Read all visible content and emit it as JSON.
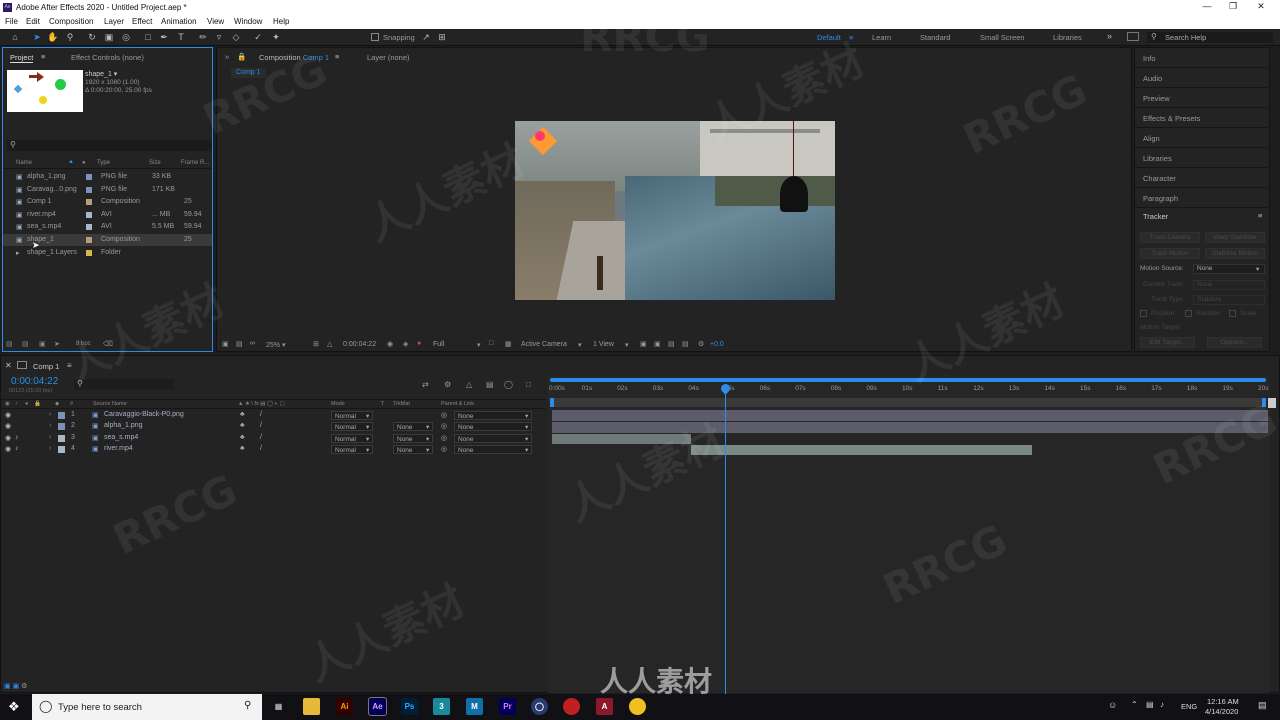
{
  "window": {
    "title": "Adobe After Effects 2020 - Untitled Project.aep *",
    "app_icon": "Ae"
  },
  "menu": [
    "File",
    "Edit",
    "Composition",
    "Layer",
    "Effect",
    "Animation",
    "View",
    "Window",
    "Help"
  ],
  "toolbar": {
    "snapping_label": "Snapping",
    "workspaces": [
      "Default",
      "Learn",
      "Standard",
      "Small Screen",
      "Libraries"
    ],
    "active_workspace": "Default",
    "search_placeholder": "Search Help"
  },
  "project_panel": {
    "tab_project": "Project",
    "tab_effect_controls": "Effect Controls (none)",
    "selected_name": "shape_1 ▾",
    "selected_res": "1920 x 1080 (1.00)",
    "selected_dur": "Δ 0:00:20:00, 25.00 fps",
    "columns": [
      "Name",
      "Type",
      "Size",
      "Frame R..."
    ],
    "items": [
      {
        "name": "alpha_1.png",
        "type": "PNG file",
        "size": "33 KB",
        "fps": "",
        "color": "#7a93b8"
      },
      {
        "name": "Caravag...0.png",
        "type": "PNG file",
        "size": "171 KB",
        "fps": "",
        "color": "#7a93b8"
      },
      {
        "name": "Comp 1",
        "type": "Composition",
        "size": "",
        "fps": "25",
        "color": "#b8a07a"
      },
      {
        "name": "river.mp4",
        "type": "AVI",
        "size": "... MB",
        "fps": "59.94",
        "color": "#a4b8c8"
      },
      {
        "name": "sea_s.mp4",
        "type": "AVI",
        "size": "5.5 MB",
        "fps": "59.94",
        "color": "#a4b8c8"
      },
      {
        "name": "shape_1",
        "type": "Composition",
        "size": "",
        "fps": "25",
        "color": "#b8a07a"
      },
      {
        "name": "shape_1 Layers",
        "type": "Folder",
        "size": "",
        "fps": "",
        "color": "#d8b84a"
      }
    ],
    "bpc": "8 bpc"
  },
  "comp_panel": {
    "tab_label": "Composition",
    "tab_comp": "Comp 1",
    "layer_tab": "Layer (none)",
    "breadcrumb": "Comp 1",
    "zoom": "25%",
    "timecode": "0:00:04:22",
    "resolution": "Full",
    "camera": "Active Camera",
    "views": "1 View",
    "exposure": "+0.0"
  },
  "right_panel": {
    "items": [
      "Info",
      "Audio",
      "Preview",
      "Effects & Presets",
      "Align",
      "Libraries",
      "Character",
      "Paragraph"
    ],
    "tracker_title": "Tracker",
    "buttons": [
      "Track Camera",
      "Warp Stabilizer",
      "Track Motion",
      "Stabilize Motion"
    ],
    "motion_source_label": "Motion Source:",
    "motion_source_value": "None",
    "current_track_label": "Current Track:",
    "current_track_value": "None",
    "track_type_label": "Track Type:",
    "track_type_value": "Stabilize",
    "checks": [
      "Position",
      "Rotation",
      "Scale"
    ],
    "motion_target": "Motion Target:",
    "edit_target": "Edit Target...",
    "options": "Options..."
  },
  "timeline": {
    "tab": "Comp 1",
    "timecode": "0:00:04:22",
    "frames": "00122 (25.00 fps)",
    "columns": {
      "num": "#",
      "source": "Source Name",
      "mode": "Mode",
      "t": "T",
      "trkmat": "TrkMat",
      "parent": "Parent & Link"
    },
    "ruler": [
      "0:00s",
      "01s",
      "02s",
      "03s",
      "04s",
      "05s",
      "06s",
      "07s",
      "08s",
      "09s",
      "10s",
      "11s",
      "12s",
      "13s",
      "14s",
      "15s",
      "16s",
      "17s",
      "18s",
      "19s",
      "20s"
    ],
    "layers": [
      {
        "num": "1",
        "name": "Caravaggio-Black-P0.png",
        "mode": "Normal",
        "trkmat": "",
        "parent": "None",
        "color": "#7a93b8",
        "audio": false
      },
      {
        "num": "2",
        "name": "alpha_1.png",
        "mode": "Normal",
        "trkmat": "None",
        "parent": "None",
        "color": "#7a93b8",
        "audio": false
      },
      {
        "num": "3",
        "name": "sea_s.mp4",
        "mode": "Normal",
        "trkmat": "None",
        "parent": "None",
        "color": "#a4b8c8",
        "audio": true
      },
      {
        "num": "4",
        "name": "river.mp4",
        "mode": "Normal",
        "trkmat": "None",
        "parent": "None",
        "color": "#a4b8c8",
        "audio": true
      }
    ]
  },
  "taskbar": {
    "search_placeholder": "Type here to search",
    "apps": [
      {
        "label": "Ai",
        "bg": "#330000",
        "fg": "#ff9a00"
      },
      {
        "label": "Ae",
        "bg": "#00005b",
        "fg": "#d8a0ff"
      },
      {
        "label": "Ps",
        "bg": "#001e36",
        "fg": "#31a8ff"
      },
      {
        "label": "3",
        "bg": "#1a8a9a",
        "fg": "#ffffff"
      },
      {
        "label": "M",
        "bg": "#0f6fa8",
        "fg": "#ffffff"
      },
      {
        "label": "Pr",
        "bg": "#00005b",
        "fg": "#e07aff"
      }
    ],
    "lang": "ENG",
    "time": "12:16 AM",
    "date": "4/14/2020"
  },
  "watermarks": [
    "RRCG",
    "人人素材"
  ]
}
